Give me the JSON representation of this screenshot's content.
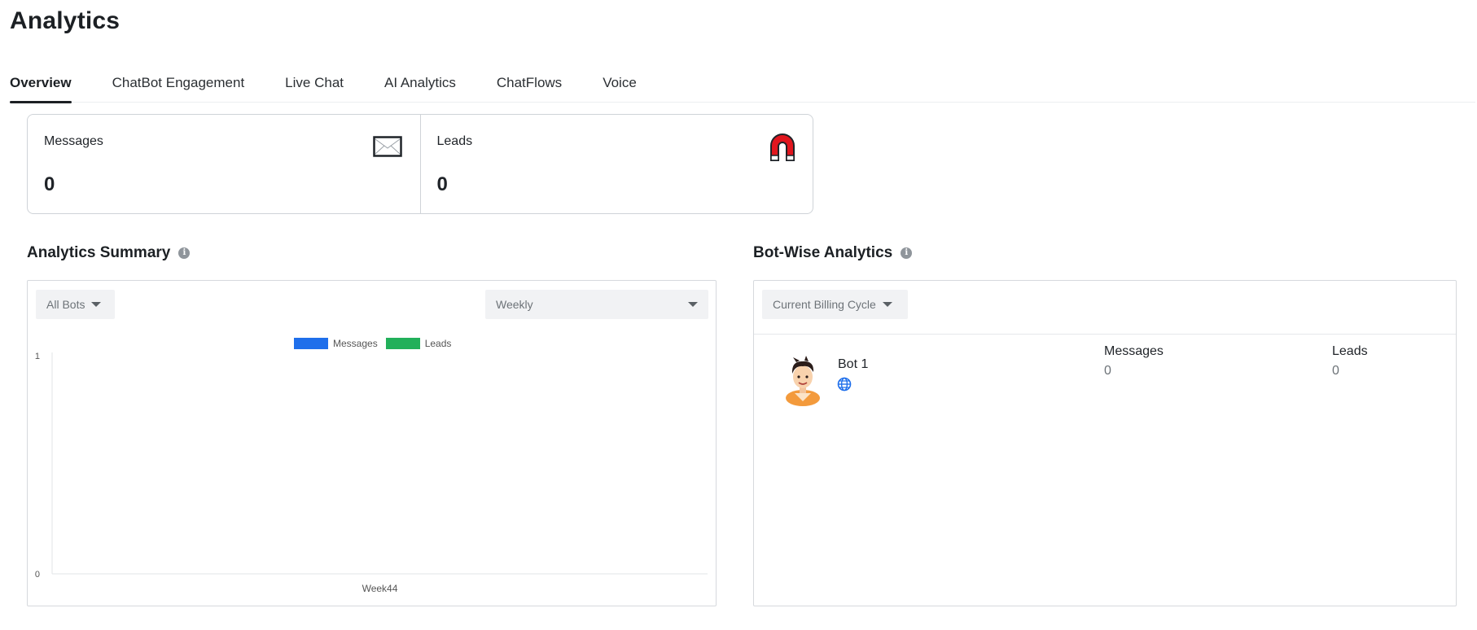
{
  "page": {
    "title": "Analytics"
  },
  "tabs": [
    {
      "label": "Overview",
      "active": true
    },
    {
      "label": "ChatBot Engagement",
      "active": false
    },
    {
      "label": "Live Chat",
      "active": false
    },
    {
      "label": "AI Analytics",
      "active": false
    },
    {
      "label": "ChatFlows",
      "active": false
    },
    {
      "label": "Voice",
      "active": false
    }
  ],
  "stats": {
    "messages": {
      "label": "Messages",
      "value": "0",
      "icon": "envelope-icon"
    },
    "leads": {
      "label": "Leads",
      "value": "0",
      "icon": "magnet-icon"
    }
  },
  "analytics_summary": {
    "title": "Analytics Summary",
    "info_glyph": "i",
    "bot_filter": "All Bots",
    "period_filter": "Weekly"
  },
  "chart_data": {
    "type": "bar",
    "categories": [
      "Week44"
    ],
    "series": [
      {
        "name": "Messages",
        "values": [
          0
        ],
        "color": "#1f6feb"
      },
      {
        "name": "Leads",
        "values": [
          0
        ],
        "color": "#22b05a"
      }
    ],
    "yticks": [
      "0",
      "1"
    ],
    "ylim": [
      0,
      1
    ],
    "legend": "top-center",
    "grid": false
  },
  "bot_wise": {
    "title": "Bot-Wise Analytics",
    "info_glyph": "i",
    "cycle_filter": "Current Billing Cycle",
    "columns": {
      "messages": "Messages",
      "leads": "Leads"
    },
    "bots": [
      {
        "name": "Bot 1",
        "channel_icon": "globe-icon",
        "avatar": "bot-avatar",
        "messages": "0",
        "leads": "0"
      }
    ]
  },
  "colors": {
    "accent": "#1f6feb",
    "leads": "#22b05a",
    "magnet_red": "#e1161e"
  }
}
